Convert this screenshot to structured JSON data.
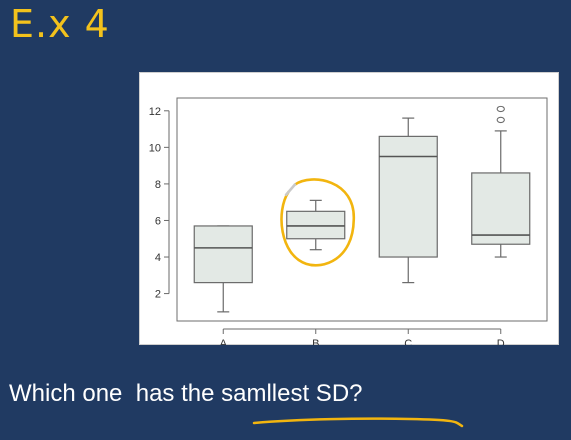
{
  "slide": {
    "title": "E.x  4",
    "question": "Which one  has the samllest SD?"
  },
  "colors": {
    "background": "#203a62",
    "title": "#f3c21c",
    "box_fill": "#e3e9e5",
    "annotation": "#f2b50f"
  },
  "chart_data": {
    "type": "boxplot",
    "categories": [
      "A",
      "B",
      "C",
      "D"
    ],
    "y_ticks": [
      "2",
      "4",
      "6",
      "8",
      "10",
      "12"
    ],
    "ylim": [
      0.5,
      12.7
    ],
    "grid": false,
    "boxes": [
      {
        "name": "A",
        "whisker_low": 1.0,
        "q1": 2.6,
        "median": 4.5,
        "q3": 5.7,
        "whisker_high": 5.7,
        "outliers": []
      },
      {
        "name": "B",
        "whisker_low": 4.4,
        "q1": 5.0,
        "median": 5.7,
        "q3": 6.5,
        "whisker_high": 7.1,
        "outliers": []
      },
      {
        "name": "C",
        "whisker_low": 2.6,
        "q1": 4.0,
        "median": 9.5,
        "q3": 10.6,
        "whisker_high": 11.6,
        "outliers": []
      },
      {
        "name": "D",
        "whisker_low": 4.0,
        "q1": 4.7,
        "median": 5.2,
        "q3": 8.6,
        "whisker_high": 10.9,
        "outliers": [
          11.5,
          12.1
        ]
      }
    ],
    "annotation": {
      "circled": "B",
      "underlined": "samllest SD"
    }
  }
}
